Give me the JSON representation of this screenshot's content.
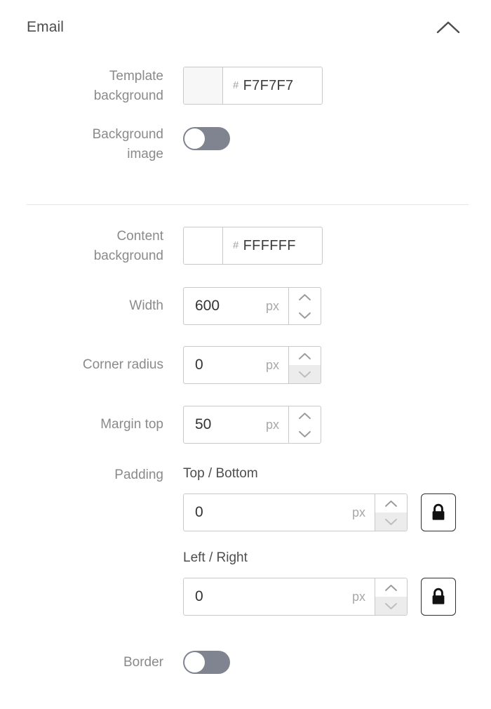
{
  "panel": {
    "title": "Email",
    "collapse_icon": "chevron-up-icon"
  },
  "fields": {
    "template_background": {
      "label": "Template\nbackground",
      "hash": "#",
      "value": "F7F7F7",
      "swatch_color": "#F7F7F7"
    },
    "background_image": {
      "label": "Background\nimage",
      "state": "off"
    },
    "content_background": {
      "label": "Content\nbackground",
      "hash": "#",
      "value": "FFFFFF",
      "swatch_color": "#FFFFFF"
    },
    "width": {
      "label": "Width",
      "value": "600",
      "unit": "px",
      "spinner_up": "chevron-up-icon",
      "spinner_down": "chevron-down-icon"
    },
    "corner_radius": {
      "label": "Corner radius",
      "value": "0",
      "unit": "px",
      "spinner_up": "chevron-up-icon",
      "spinner_down": "chevron-down-icon"
    },
    "margin_top": {
      "label": "Margin top",
      "value": "50",
      "unit": "px",
      "spinner_up": "chevron-up-icon",
      "spinner_down": "chevron-down-icon"
    },
    "padding": {
      "label": "Padding",
      "top_bottom": {
        "label": "Top / Bottom",
        "value": "0",
        "unit": "px",
        "lock_icon": "lock-closed-icon"
      },
      "left_right": {
        "label": "Left / Right",
        "value": "0",
        "unit": "px",
        "lock_icon": "lock-closed-icon"
      }
    },
    "border": {
      "label": "Border",
      "state": "off"
    }
  },
  "colors": {
    "label_gray": "#8a8a8a",
    "text_dark": "#3c3c3c",
    "border_gray": "#c9c9c9",
    "toggle_off_track": "#7f8490",
    "spinner_active_bg": "#ececec",
    "divider": "#e6e6e6"
  }
}
